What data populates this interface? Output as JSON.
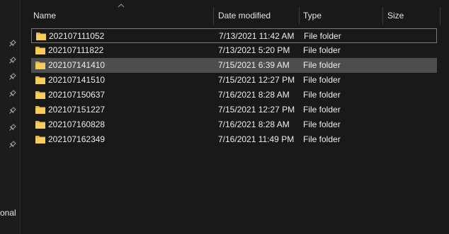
{
  "nav": {
    "partial_label": "onal",
    "pins": [
      "pin-icon",
      "pin-icon",
      "pin-icon",
      "pin-icon",
      "pin-icon",
      "pin-icon",
      "pin-icon"
    ]
  },
  "columns": {
    "name": "Name",
    "date_modified": "Date modified",
    "type": "Type",
    "size": "Size",
    "sorted_by": "name",
    "sort_direction": "ascending"
  },
  "files": [
    {
      "name": "202107111052",
      "date": "7/13/2021 11:42 AM",
      "type": "File folder",
      "state": "focused"
    },
    {
      "name": "202107111822",
      "date": "7/13/2021 5:20 PM",
      "type": "File folder",
      "state": "normal"
    },
    {
      "name": "202107141410",
      "date": "7/15/2021 6:39 AM",
      "type": "File folder",
      "state": "selected"
    },
    {
      "name": "202107141510",
      "date": "7/15/2021 12:27 PM",
      "type": "File folder",
      "state": "normal"
    },
    {
      "name": "202107150637",
      "date": "7/16/2021 8:28 AM",
      "type": "File folder",
      "state": "normal"
    },
    {
      "name": "202107151227",
      "date": "7/15/2021 12:27 PM",
      "type": "File folder",
      "state": "normal"
    },
    {
      "name": "202107160828",
      "date": "7/16/2021 8:28 AM",
      "type": "File folder",
      "state": "normal"
    },
    {
      "name": "202107162349",
      "date": "7/16/2021 11:49 PM",
      "type": "File folder",
      "state": "normal"
    }
  ],
  "colors": {
    "background": "#191919",
    "selected_row": "#4d4d4d",
    "focus_border": "#7a7a7a",
    "folder_yellow": "#f4cd5a"
  }
}
